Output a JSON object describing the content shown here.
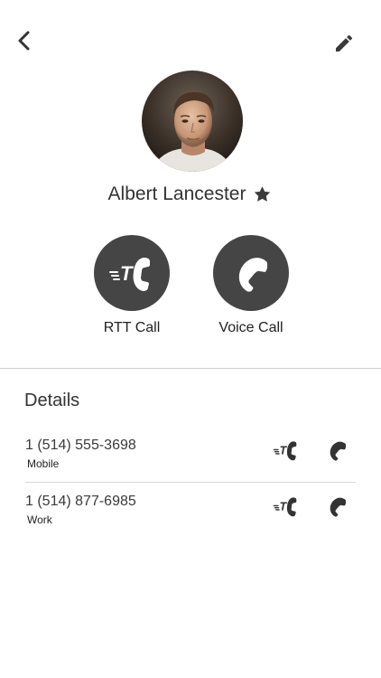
{
  "header": {
    "back_icon": "chevron-left-icon",
    "edit_icon": "pencil-icon"
  },
  "contact": {
    "name": "Albert Lancester",
    "favorite": true,
    "favorite_icon": "star-icon"
  },
  "actions": [
    {
      "label": "RTT Call",
      "icon": "rtt-phone-icon"
    },
    {
      "label": "Voice Call",
      "icon": "phone-icon"
    }
  ],
  "details": {
    "title": "Details",
    "numbers": [
      {
        "number": "1 (514) 555-3698",
        "type": "Mobile"
      },
      {
        "number": "1 (514) 877-6985",
        "type": "Work"
      }
    ]
  },
  "colors": {
    "button_bg": "#454545",
    "icon": "#333333",
    "divider": "#cfcfcf"
  }
}
